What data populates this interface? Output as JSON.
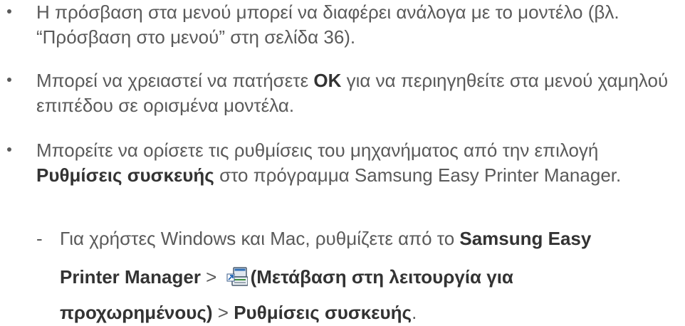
{
  "bullets": [
    {
      "text": "Η πρόσβαση στα μενού μπορεί να διαφέρει ανάλογα με το μοντέλο (βλ. “Πρόσβαση στο μενού” στη σελίδα 36)."
    },
    {
      "prefix": "Μπορεί να χρειαστεί να πατήσετε ",
      "bold": "OK",
      "suffix": " για να περιηγηθείτε στα μενού χαμηλού επιπέδου σε ορισμένα μοντέλα."
    },
    {
      "prefix": "Μπορείτε να ορίσετε τις ρυθμίσεις του μηχανήματος από την επιλογή ",
      "bold": "Ρυθμίσεις συσκευής",
      "suffix": " στο πρόγραμμα Samsung Easy Printer Manager."
    }
  ],
  "sub_bullet": {
    "dash": "-",
    "prefix": "Για χρήστες Windows και Mac, ρυθμίζετε από το ",
    "bold1": "Samsung Easy",
    "bold2": "Printer Manager",
    "sep1": " > ",
    "icon": "advanced-mode-icon",
    "bold3": "(Μετάβαση στη λειτουργία για",
    "bold4": "προχωρημένους)",
    "sep2": " > ",
    "bold5": "Ρυθμίσεις συσκευής",
    "end": "."
  }
}
